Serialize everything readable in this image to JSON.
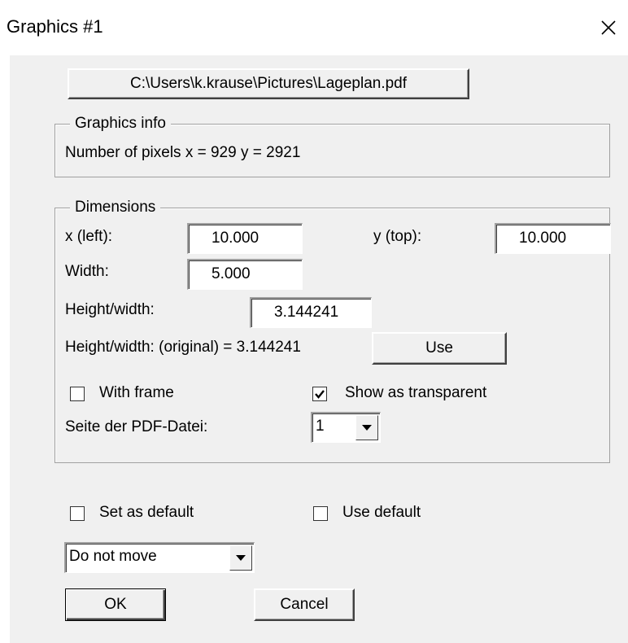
{
  "window": {
    "title": "Graphics  #1",
    "close_glyph": "✕"
  },
  "file_button": {
    "label": "C:\\Users\\k.krause\\Pictures\\Lageplan.pdf"
  },
  "graphics_info": {
    "legend": "Graphics info",
    "pixels_text": "Number of pixels x = 929  y = 2921"
  },
  "dimensions": {
    "legend": "Dimensions",
    "x_label": "x (left):",
    "x_value": "10.000",
    "y_label": "y (top):",
    "y_value": "10.000",
    "width_label": "Width:",
    "width_value": "5.000",
    "hw_label": "Height/width:",
    "hw_value": "3.144241",
    "hw_original_text": "Height/width: (original) = 3.144241",
    "use_label": "Use",
    "with_frame_label": "With frame",
    "with_frame_checked": false,
    "transparent_label": "Show as transparent",
    "transparent_checked": true,
    "pdf_page_label": "Seite der PDF-Datei:",
    "pdf_page_value": "1"
  },
  "bottom": {
    "set_default_label": "Set as default",
    "set_default_checked": false,
    "use_default_label": "Use default",
    "use_default_checked": false,
    "move_select_value": "Do not move",
    "ok_label": "OK",
    "cancel_label": "Cancel"
  },
  "colors": {
    "dialog_bg": "#f0f0f0",
    "titlebar_bg": "#ffffff"
  },
  "icons": {
    "close": "close-icon",
    "dropdown": "chevron-down-icon",
    "check": "checkmark-icon"
  }
}
